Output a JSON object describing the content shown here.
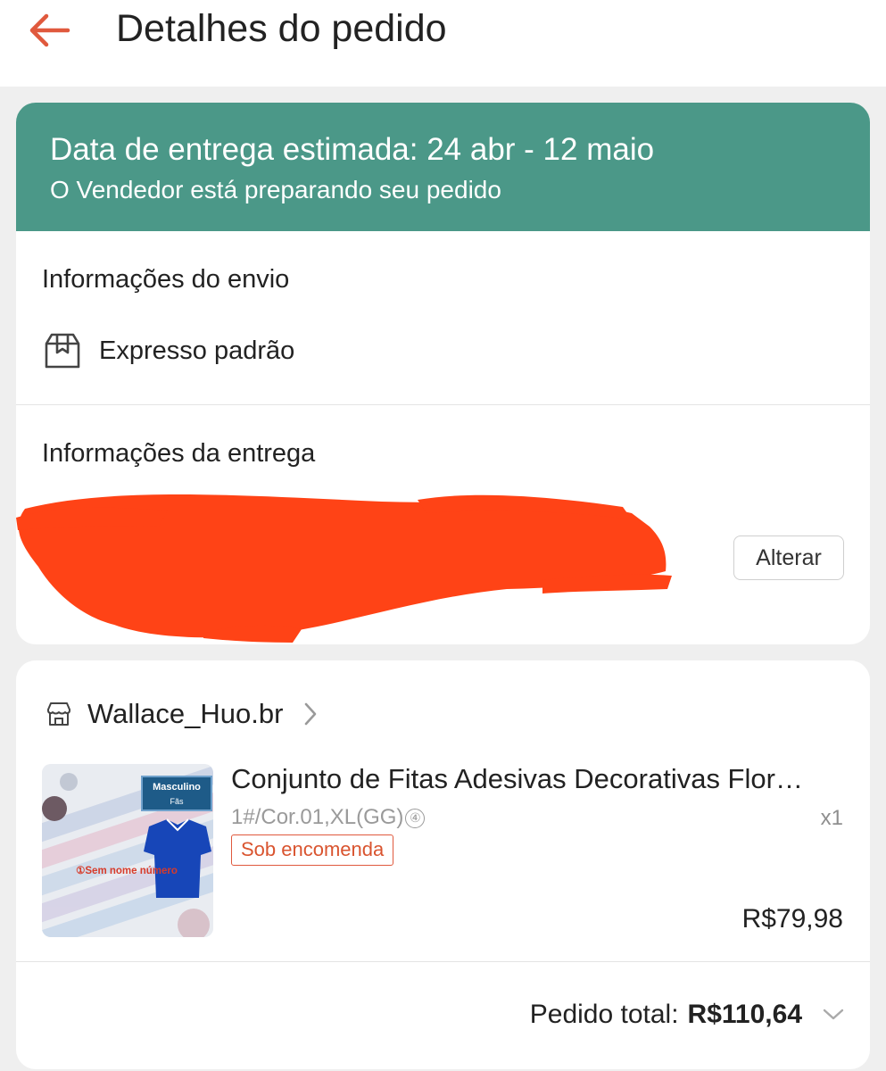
{
  "header": {
    "title": "Detalhes do pedido",
    "back_icon": "arrow-left-icon",
    "accent_color": "#e0593d"
  },
  "delivery_status": {
    "title": "Data de entrega estimada: 24 abr - 12 maio",
    "subtitle": "O Vendedor está preparando seu pedido",
    "background_color": "#4b9888"
  },
  "shipping_info": {
    "heading": "Informações do envio",
    "method_icon": "package-box-icon",
    "method": "Expresso padrão"
  },
  "delivery_info": {
    "heading": "Informações da entrega",
    "address_redacted": true,
    "redaction_color": "#ff4316",
    "change_button": "Alterar"
  },
  "order": {
    "store_icon": "store-icon",
    "store_name": "Wallace_Huo.br",
    "product": {
      "title": "Conjunto de Fitas Adesivas Decorativas Flor…",
      "variant": "1#/Cor.01,XL(GG)",
      "variant_badge": "④",
      "quantity": "x1",
      "status_badge": "Sob encomenda",
      "price": "R$79,98",
      "thumbnail_overlay": {
        "label_top": "Masculino",
        "label_sub": "Fãs",
        "caption": "①Sem nome número"
      }
    },
    "total_label": "Pedido total:",
    "total_value": "R$110,64"
  }
}
